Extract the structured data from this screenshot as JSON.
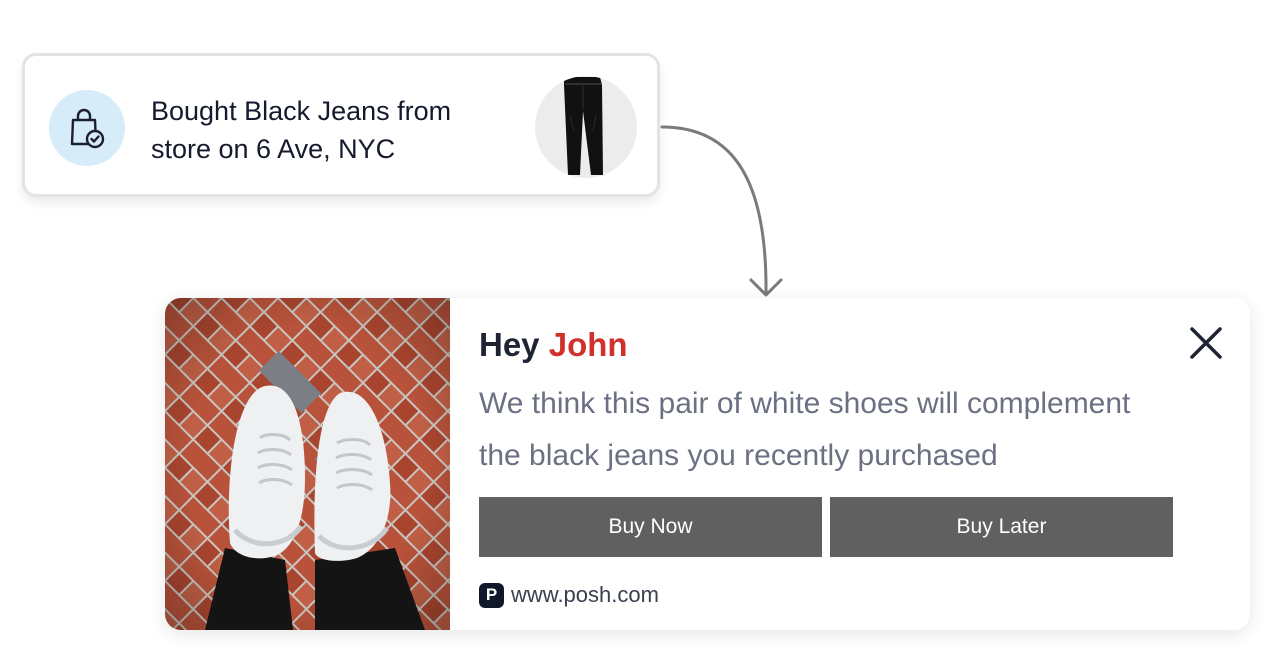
{
  "purchase_notice": {
    "line1": "Bought Black Jeans from",
    "line2": "store on 6 Ave, NYC",
    "icon": "shopping-bag-check-icon",
    "product_image": "black-jeans",
    "badge_color": "#d6ecf8"
  },
  "recommendation": {
    "greeting": "Hey",
    "name": "John",
    "name_color": "#d1312c",
    "message_line1": "We think this pair of white shoes will complement",
    "message_line2": "the black jeans you recently purchased",
    "image": "white-sneakers-on-brick-pavement",
    "buy_now_label": "Buy Now",
    "buy_later_label": "Buy Later",
    "button_color": "#606060",
    "close_icon": "close-icon",
    "site_logo_letter": "P",
    "site_url": "www.posh.com"
  }
}
